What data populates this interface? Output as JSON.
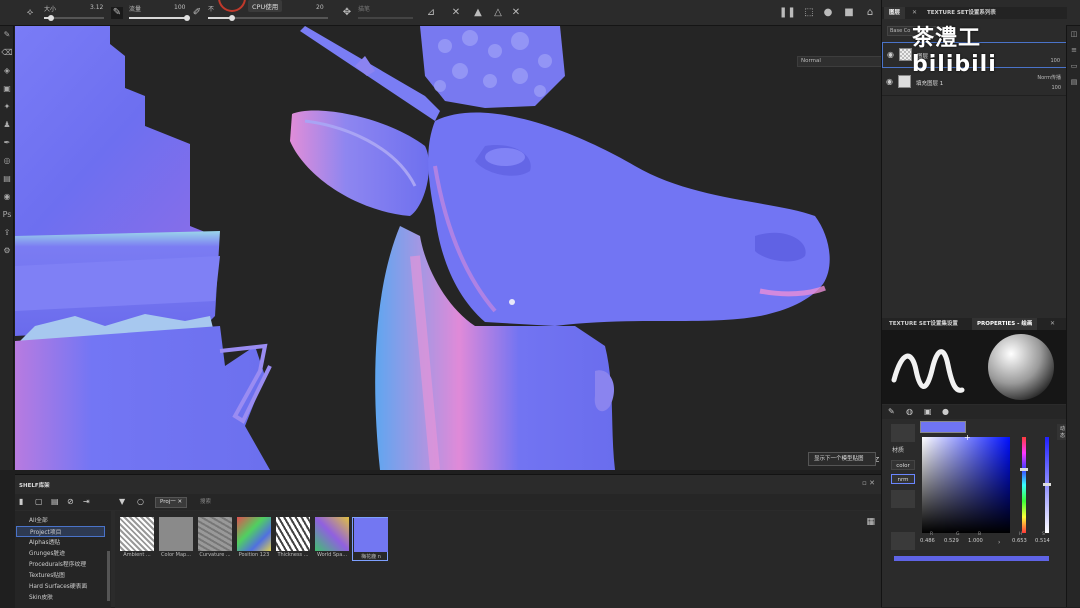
{
  "topbar": {
    "size_label": "大小",
    "size_value": "3.12",
    "size_fill": 0.12,
    "flow_label": "流量",
    "flow_value": "100",
    "flow_fill": 1.0,
    "opacity_label": "不",
    "spacing_value": "20",
    "spacing_fill": 0.2,
    "stroke_label": "描笔",
    "cpu_label": "CPU使用"
  },
  "left_tools": [
    "brush-icon",
    "eraser-icon",
    "projection-icon",
    "geometry-mask-icon",
    "smudge-icon",
    "clone-icon",
    "picker-icon",
    "particle-icon",
    "bake-icon",
    "layer-icon",
    "ps-icon",
    "export-icon",
    "settings-icon"
  ],
  "viewport": {
    "mode_select": "Normal",
    "tooltip": "显示下一个模型贴图",
    "axis_label": "Y Z"
  },
  "right_panel": {
    "tabs_top": [
      "图层",
      "TEXTURE SET设置系列表"
    ],
    "blend_select": "Base Co",
    "watermark": "茶澧工 bilibili",
    "layers": [
      {
        "name": "图层 1",
        "opacity": "100"
      },
      {
        "name": "填充图层 1",
        "blend": "Norm传播",
        "opacity": "100"
      }
    ],
    "tabs_props": [
      "TEXTURE SET设置集设置",
      "PROPERTIES - 绘画"
    ],
    "material_label": "材质",
    "channels": [
      "color",
      "nrm"
    ],
    "picker": {
      "saturation_label": "动态",
      "color": "#6f74f2",
      "labels": [
        "R",
        "G",
        "B",
        "",
        "H",
        "S",
        "V"
      ],
      "values": [
        "0.486",
        "0.529",
        "1.000",
        "",
        "0.653",
        "0.514",
        "1.000"
      ]
    }
  },
  "shelf": {
    "title": "SHELF库架",
    "filter_tag": "Proj一",
    "search_placeholder": "搜索",
    "categories": [
      "All全部",
      "Project项目",
      "Alphas透贴",
      "Grunges脏迹",
      "Procedurals程序纹理",
      "Textures贴图",
      "Hard Surfaces硬表面",
      "Skin皮肤"
    ],
    "selected_category": 1,
    "resources": [
      {
        "caption": "Ambient ..."
      },
      {
        "caption": "Color Map..."
      },
      {
        "caption": "Curvature ..."
      },
      {
        "caption": "Position 123"
      },
      {
        "caption": "Thickness ..."
      },
      {
        "caption": "World Spa..."
      },
      {
        "caption": "梅花鹿 n"
      }
    ]
  }
}
